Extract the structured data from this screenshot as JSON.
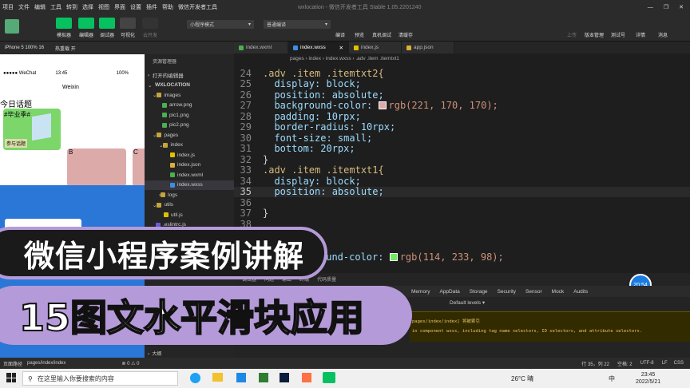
{
  "menu": [
    "项目",
    "文件",
    "编辑",
    "工具",
    "转到",
    "选择",
    "视图",
    "界面",
    "设置",
    "插件",
    "帮助",
    "微信开发者工具"
  ],
  "window_title": "wxlocation - 微信开发者工具 Stable 1.05.2201240",
  "toolbar": {
    "simulator": "模拟器",
    "editor": "编辑器",
    "debugger": "调试器",
    "visual": "可视化",
    "cloud": "云开发",
    "mode": "小程序模式",
    "compile_mode": "普通编译",
    "compile": "编译",
    "preview": "预览",
    "remote_debug": "真机调试",
    "clear_cache": "清缓存",
    "upload": "上传",
    "version": "版本管理",
    "test": "测试号",
    "details": "详情",
    "messages": "消息"
  },
  "sim": {
    "device": "iPhone 5 100% 16",
    "hot_reload": "热重载 开",
    "carrier": "●●●●● WeChat",
    "time": "13:45",
    "battery": "100%",
    "nav_title": "Weixin",
    "section": "今日话题",
    "card_tag": "#毕业季#",
    "card_btn": "参与话题",
    "letter_b": "B",
    "letter_c": "C"
  },
  "explorer": {
    "header": "资源管理器",
    "open_editors": "打开的编辑器",
    "project": "WXLOCATION",
    "items": [
      "images",
      "arrow.png",
      "pic1.png",
      "pic2.png",
      "pages",
      "index",
      "index.js",
      "index.json",
      "index.wxml",
      "index.wxss",
      "logs",
      "utils",
      "util.js",
      ".eslintrc.js"
    ],
    "outline": "大纲"
  },
  "tabs": [
    "index.wxml",
    "index.wxss",
    "index.js",
    "app.json"
  ],
  "breadcrumb": "pages › index › index.wxss › .adv .item .itemtxt1",
  "code": [
    {
      "n": "24",
      "t": ".adv .item .itemtxt2{"
    },
    {
      "n": "25",
      "t": "  display: block;"
    },
    {
      "n": "26",
      "t": "  position: absolute;"
    },
    {
      "n": "27",
      "t": "  background-color: ",
      "c": "rgb(221, 170, 170);"
    },
    {
      "n": "28",
      "t": "  padding: 10rpx;"
    },
    {
      "n": "29",
      "t": "  border-radius: 10rpx;"
    },
    {
      "n": "30",
      "t": "  font-size: small;"
    },
    {
      "n": "31",
      "t": "  bottom: 20rpx;"
    },
    {
      "n": "32",
      "t": "}"
    },
    {
      "n": "33",
      "t": ".adv .item .itemtxt1{"
    },
    {
      "n": "34",
      "t": "  display: block;"
    },
    {
      "n": "35",
      "t": "  position: absolute;"
    },
    {
      "n": "36",
      "t": ""
    },
    {
      "n": "37",
      "t": "}"
    },
    {
      "n": "38",
      "t": ""
    }
  ],
  "code_tail": "ound-color: ",
  "code_tail_color": "rgb(114, 233, 98);",
  "devtools": {
    "tabs1": [
      "调试器",
      "问题",
      "输出",
      "终端",
      "代码质量"
    ],
    "tabs2": [
      "Memory",
      "AppData",
      "Storage",
      "Security",
      "Sensor",
      "Mock",
      "Audits"
    ],
    "levels": "Default levels ▾",
    "msg1": "pages/index/index] 将被索引",
    "msg2": "in component wxss, including tag name selectors, ID selectors, and attribute selectors.",
    "timer": "20:54"
  },
  "status": {
    "path": "页面路径",
    "page": "pages/index/index",
    "errors": "⊗ 0 ⚠ 0",
    "pos": "行 35，列 22",
    "spaces": "空格: 2",
    "enc": "UTF-8",
    "eol": "LF",
    "lang": "CSS"
  },
  "banner1": "微信小程序案例讲解",
  "banner2": "15图文水平滑块应用",
  "taskbar": {
    "search": "在这里输入你要搜索的内容",
    "weather": "26°C 晴",
    "ime": "中",
    "time": "23:45",
    "date": "2022/5/21"
  },
  "colors": {
    "accent": "#07c160",
    "banner_purple": "#b49ad8"
  }
}
